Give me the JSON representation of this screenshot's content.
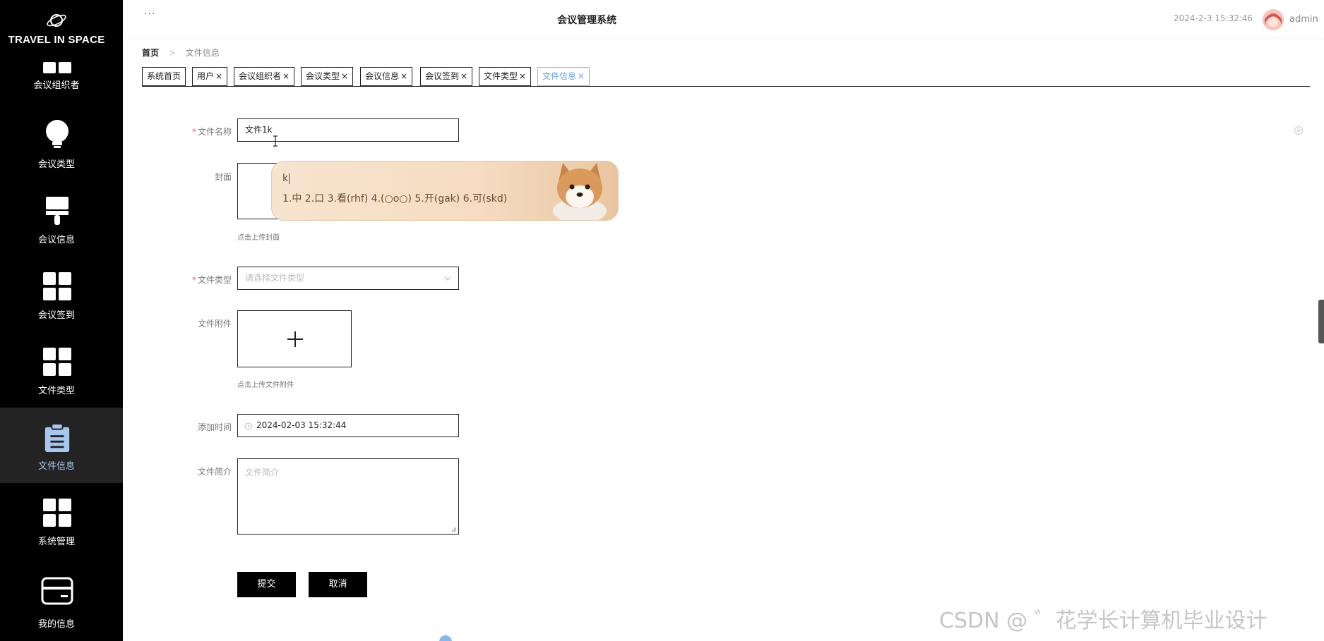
{
  "sidebar": {
    "logo": "TRAVEL IN SPACE",
    "items": [
      {
        "label": "会议组织者",
        "icon": "grid-icon"
      },
      {
        "label": "会议类型",
        "icon": "lightbulb-icon"
      },
      {
        "label": "会议信息",
        "icon": "brush-icon"
      },
      {
        "label": "会议签到",
        "icon": "grid-icon"
      },
      {
        "label": "文件类型",
        "icon": "grid-icon"
      },
      {
        "label": "文件信息",
        "icon": "clipboard-icon"
      },
      {
        "label": "系统管理",
        "icon": "grid-icon"
      },
      {
        "label": "我的信息",
        "icon": "card-icon"
      }
    ],
    "active_index": 5
  },
  "header": {
    "menu_glyph": "···",
    "title": "会议管理系统",
    "datetime": "2024-2-3 15:32:46",
    "user": "admin"
  },
  "breadcrumb": {
    "home": "首页",
    "current": "文件信息"
  },
  "tabs": [
    {
      "label": "系统首页",
      "closable": false
    },
    {
      "label": "用户",
      "closable": true
    },
    {
      "label": "会议组织者",
      "closable": true
    },
    {
      "label": "会议类型",
      "closable": true
    },
    {
      "label": "会议信息",
      "closable": true
    },
    {
      "label": "会议签到",
      "closable": true
    },
    {
      "label": "文件类型",
      "closable": true
    },
    {
      "label": "文件信息",
      "closable": true,
      "active": true
    }
  ],
  "close_glyph": "×",
  "form": {
    "required_mark": "*",
    "name": {
      "label": "文件名称",
      "value": "文件1k"
    },
    "cover": {
      "label": "封面",
      "hint": "点击上传封面"
    },
    "type": {
      "label": "文件类型",
      "placeholder": "请选择文件类型"
    },
    "attachment": {
      "label": "文件附件",
      "hint": "点击上传文件附件",
      "plus": "+"
    },
    "time": {
      "label": "添加时间",
      "value": "2024-02-03 15:32:44"
    },
    "summary": {
      "label": "文件简介",
      "placeholder": "文件简介"
    },
    "submit": "提交",
    "cancel": "取消"
  },
  "ime": {
    "composition": "k",
    "candidates": "1.中  2.口  3.看(rhf)  4.(○o○)  5.开(gak)  6.可(skd)"
  },
  "watermark": "CSDN @  ゛花学长计算机毕业设计",
  "colors": {
    "sidebar_bg": "#000000",
    "active_tab": "#6aa3e3",
    "button_bg": "#000000"
  }
}
